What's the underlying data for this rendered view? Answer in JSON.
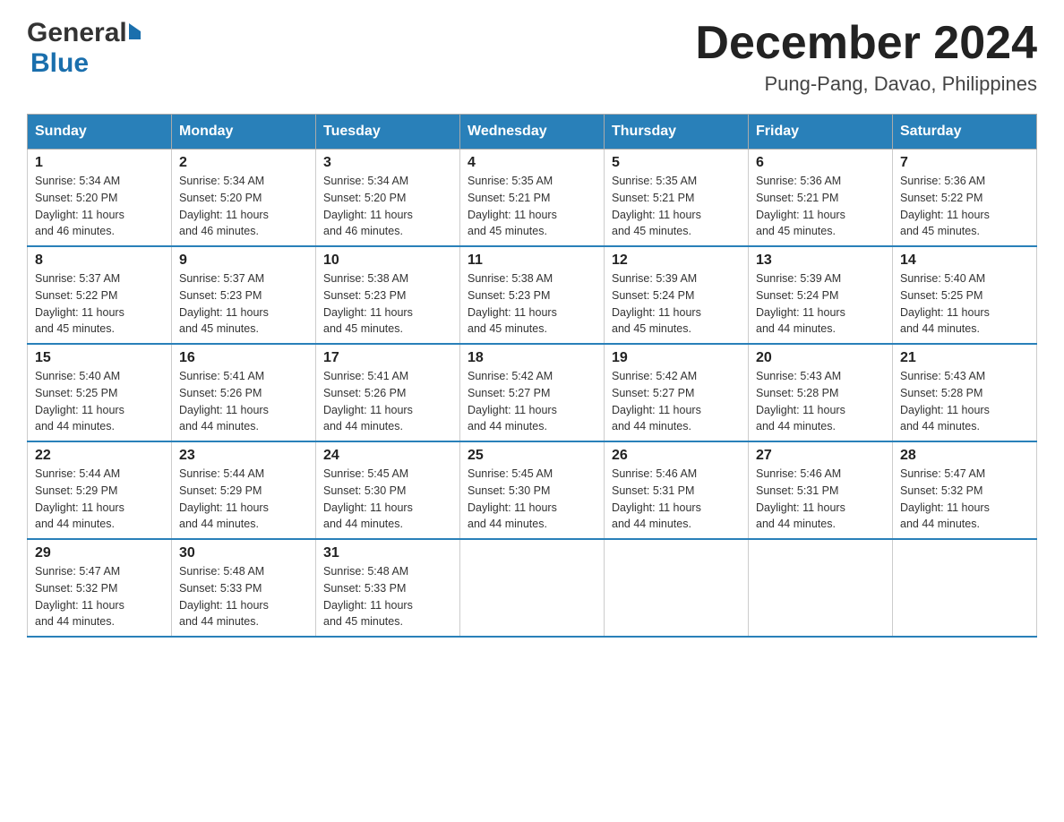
{
  "logo": {
    "general": "General",
    "blue": "Blue"
  },
  "title": "December 2024",
  "location": "Pung-Pang, Davao, Philippines",
  "weekdays": [
    "Sunday",
    "Monday",
    "Tuesday",
    "Wednesday",
    "Thursday",
    "Friday",
    "Saturday"
  ],
  "weeks": [
    [
      {
        "day": "1",
        "sunrise": "5:34 AM",
        "sunset": "5:20 PM",
        "daylight": "11 hours and 46 minutes."
      },
      {
        "day": "2",
        "sunrise": "5:34 AM",
        "sunset": "5:20 PM",
        "daylight": "11 hours and 46 minutes."
      },
      {
        "day": "3",
        "sunrise": "5:34 AM",
        "sunset": "5:20 PM",
        "daylight": "11 hours and 46 minutes."
      },
      {
        "day": "4",
        "sunrise": "5:35 AM",
        "sunset": "5:21 PM",
        "daylight": "11 hours and 45 minutes."
      },
      {
        "day": "5",
        "sunrise": "5:35 AM",
        "sunset": "5:21 PM",
        "daylight": "11 hours and 45 minutes."
      },
      {
        "day": "6",
        "sunrise": "5:36 AM",
        "sunset": "5:21 PM",
        "daylight": "11 hours and 45 minutes."
      },
      {
        "day": "7",
        "sunrise": "5:36 AM",
        "sunset": "5:22 PM",
        "daylight": "11 hours and 45 minutes."
      }
    ],
    [
      {
        "day": "8",
        "sunrise": "5:37 AM",
        "sunset": "5:22 PM",
        "daylight": "11 hours and 45 minutes."
      },
      {
        "day": "9",
        "sunrise": "5:37 AM",
        "sunset": "5:23 PM",
        "daylight": "11 hours and 45 minutes."
      },
      {
        "day": "10",
        "sunrise": "5:38 AM",
        "sunset": "5:23 PM",
        "daylight": "11 hours and 45 minutes."
      },
      {
        "day": "11",
        "sunrise": "5:38 AM",
        "sunset": "5:23 PM",
        "daylight": "11 hours and 45 minutes."
      },
      {
        "day": "12",
        "sunrise": "5:39 AM",
        "sunset": "5:24 PM",
        "daylight": "11 hours and 45 minutes."
      },
      {
        "day": "13",
        "sunrise": "5:39 AM",
        "sunset": "5:24 PM",
        "daylight": "11 hours and 44 minutes."
      },
      {
        "day": "14",
        "sunrise": "5:40 AM",
        "sunset": "5:25 PM",
        "daylight": "11 hours and 44 minutes."
      }
    ],
    [
      {
        "day": "15",
        "sunrise": "5:40 AM",
        "sunset": "5:25 PM",
        "daylight": "11 hours and 44 minutes."
      },
      {
        "day": "16",
        "sunrise": "5:41 AM",
        "sunset": "5:26 PM",
        "daylight": "11 hours and 44 minutes."
      },
      {
        "day": "17",
        "sunrise": "5:41 AM",
        "sunset": "5:26 PM",
        "daylight": "11 hours and 44 minutes."
      },
      {
        "day": "18",
        "sunrise": "5:42 AM",
        "sunset": "5:27 PM",
        "daylight": "11 hours and 44 minutes."
      },
      {
        "day": "19",
        "sunrise": "5:42 AM",
        "sunset": "5:27 PM",
        "daylight": "11 hours and 44 minutes."
      },
      {
        "day": "20",
        "sunrise": "5:43 AM",
        "sunset": "5:28 PM",
        "daylight": "11 hours and 44 minutes."
      },
      {
        "day": "21",
        "sunrise": "5:43 AM",
        "sunset": "5:28 PM",
        "daylight": "11 hours and 44 minutes."
      }
    ],
    [
      {
        "day": "22",
        "sunrise": "5:44 AM",
        "sunset": "5:29 PM",
        "daylight": "11 hours and 44 minutes."
      },
      {
        "day": "23",
        "sunrise": "5:44 AM",
        "sunset": "5:29 PM",
        "daylight": "11 hours and 44 minutes."
      },
      {
        "day": "24",
        "sunrise": "5:45 AM",
        "sunset": "5:30 PM",
        "daylight": "11 hours and 44 minutes."
      },
      {
        "day": "25",
        "sunrise": "5:45 AM",
        "sunset": "5:30 PM",
        "daylight": "11 hours and 44 minutes."
      },
      {
        "day": "26",
        "sunrise": "5:46 AM",
        "sunset": "5:31 PM",
        "daylight": "11 hours and 44 minutes."
      },
      {
        "day": "27",
        "sunrise": "5:46 AM",
        "sunset": "5:31 PM",
        "daylight": "11 hours and 44 minutes."
      },
      {
        "day": "28",
        "sunrise": "5:47 AM",
        "sunset": "5:32 PM",
        "daylight": "11 hours and 44 minutes."
      }
    ],
    [
      {
        "day": "29",
        "sunrise": "5:47 AM",
        "sunset": "5:32 PM",
        "daylight": "11 hours and 44 minutes."
      },
      {
        "day": "30",
        "sunrise": "5:48 AM",
        "sunset": "5:33 PM",
        "daylight": "11 hours and 44 minutes."
      },
      {
        "day": "31",
        "sunrise": "5:48 AM",
        "sunset": "5:33 PM",
        "daylight": "11 hours and 45 minutes."
      },
      null,
      null,
      null,
      null
    ]
  ],
  "labels": {
    "sunrise": "Sunrise:",
    "sunset": "Sunset:",
    "daylight": "Daylight:"
  }
}
